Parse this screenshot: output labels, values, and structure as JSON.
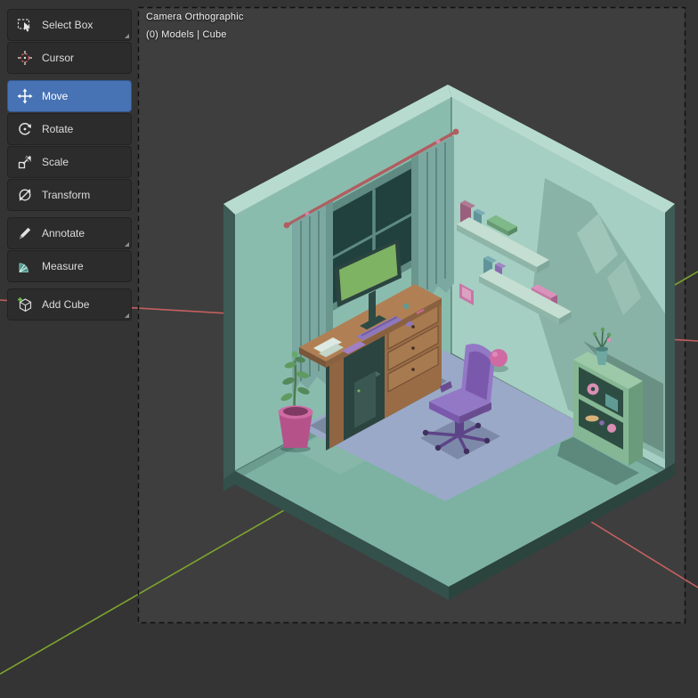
{
  "viewport": {
    "title": "Camera Orthographic",
    "info": "(0) Models | Cube"
  },
  "toolbar": {
    "items": [
      {
        "label": "Select Box",
        "icon": "select-box-icon",
        "active": false,
        "has_submenu": true
      },
      {
        "label": "Cursor",
        "icon": "cursor-icon",
        "active": false,
        "has_submenu": false
      },
      {
        "label": "Move",
        "icon": "move-icon",
        "active": true,
        "has_submenu": false
      },
      {
        "label": "Rotate",
        "icon": "rotate-icon",
        "active": false,
        "has_submenu": false
      },
      {
        "label": "Scale",
        "icon": "scale-icon",
        "active": false,
        "has_submenu": false
      },
      {
        "label": "Transform",
        "icon": "transform-icon",
        "active": false,
        "has_submenu": false
      },
      {
        "label": "Annotate",
        "icon": "annotate-icon",
        "active": false,
        "has_submenu": true
      },
      {
        "label": "Measure",
        "icon": "measure-icon",
        "active": false,
        "has_submenu": false
      },
      {
        "label": "Add Cube",
        "icon": "add-cube-icon",
        "active": false,
        "has_submenu": true
      }
    ]
  },
  "scene": {
    "description": "Isometric low-poly bedroom model viewed through an orthographic camera",
    "objects": [
      "room",
      "window",
      "curtains",
      "curtain rod",
      "wall shelves",
      "books",
      "wall picture",
      "desk",
      "drawers",
      "PC tower",
      "monitor",
      "keyboard",
      "mouse",
      "papers",
      "office chair",
      "rug",
      "potted plant",
      "ball",
      "storage shelf",
      "vase",
      "donut"
    ]
  },
  "palette": {
    "accent": "#4772b3",
    "bg_outer": "#343434",
    "bg_camera": "#3e3e3e",
    "toolbar_btn": "#2c2c2c",
    "axis_x": "#c46060",
    "axis_y": "#7da32f",
    "wall_left": "#8abcae",
    "wall_right": "#a5cfc2",
    "wall_top": "#b7dccf",
    "wall_edge": "#3f5b56",
    "floor": "#7db2a3",
    "slab": "#33504b",
    "rug": "#9aa9c7",
    "desk": "#b08054",
    "screen": "#7eb363",
    "chair": "#9378c6",
    "curtain": "#7ba8a0",
    "window_glass": "#21413e",
    "window_frame": "#5e8a82",
    "curtain_rod": "#b05e60",
    "plant_pot": "#b5528a",
    "plant": "#5f9a5f",
    "shelf_unit": "#86b794",
    "accent_pink": "#d98fb4",
    "camera_border": "#101010"
  }
}
